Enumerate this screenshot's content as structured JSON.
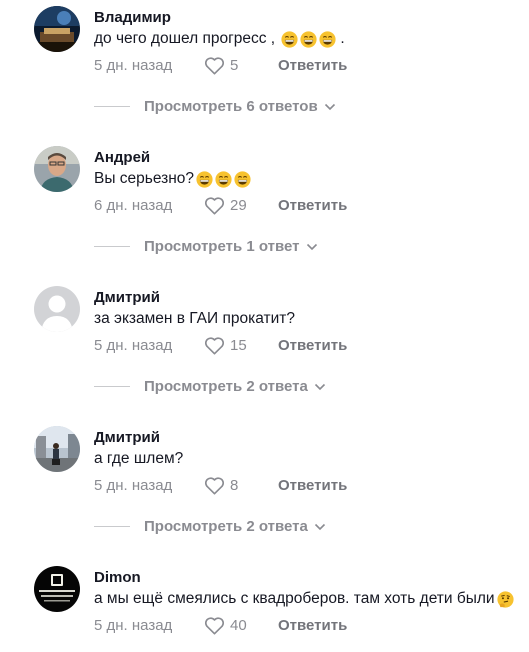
{
  "comments": [
    {
      "author": "Владимир",
      "text": "до чего дошел прогресс ,",
      "emojis": [
        "grin-emoji",
        "grin-emoji",
        "grin-emoji"
      ],
      "trailing": " .",
      "time": "5 дн. назад",
      "likes": "5",
      "reply_label": "Ответить",
      "replies_label": "Просмотреть 6 ответов",
      "avatar": "dark-photo"
    },
    {
      "author": "Андрей",
      "text": "Вы серьезно?",
      "emojis": [
        "grin-emoji",
        "grin-emoji",
        "grin-emoji"
      ],
      "trailing": "",
      "time": "6 дн. назад",
      "likes": "29",
      "reply_label": "Ответить",
      "replies_label": "Просмотреть 1 ответ",
      "avatar": "man-photo"
    },
    {
      "author": "Дмитрий",
      "text": "за экзамен в ГАИ прокатит?",
      "emojis": [],
      "trailing": "",
      "time": "5 дн. назад",
      "likes": "15",
      "reply_label": "Ответить",
      "replies_label": "Просмотреть 2 ответа",
      "avatar": "default-person"
    },
    {
      "author": "Дмитрий",
      "text": "а где шлем?",
      "emojis": [],
      "trailing": "",
      "time": "5 дн. назад",
      "likes": "8",
      "reply_label": "Ответить",
      "replies_label": "Просмотреть 2 ответа",
      "avatar": "street-photo"
    },
    {
      "author": "Dimon",
      "text": "а мы ещё смеялись с квадроберов. там хоть дети были",
      "emojis": [
        "thinking-emoji"
      ],
      "trailing": "",
      "time": "5 дн. назад",
      "likes": "40",
      "reply_label": "Ответить",
      "replies_label": "",
      "avatar": "black-logo"
    }
  ]
}
